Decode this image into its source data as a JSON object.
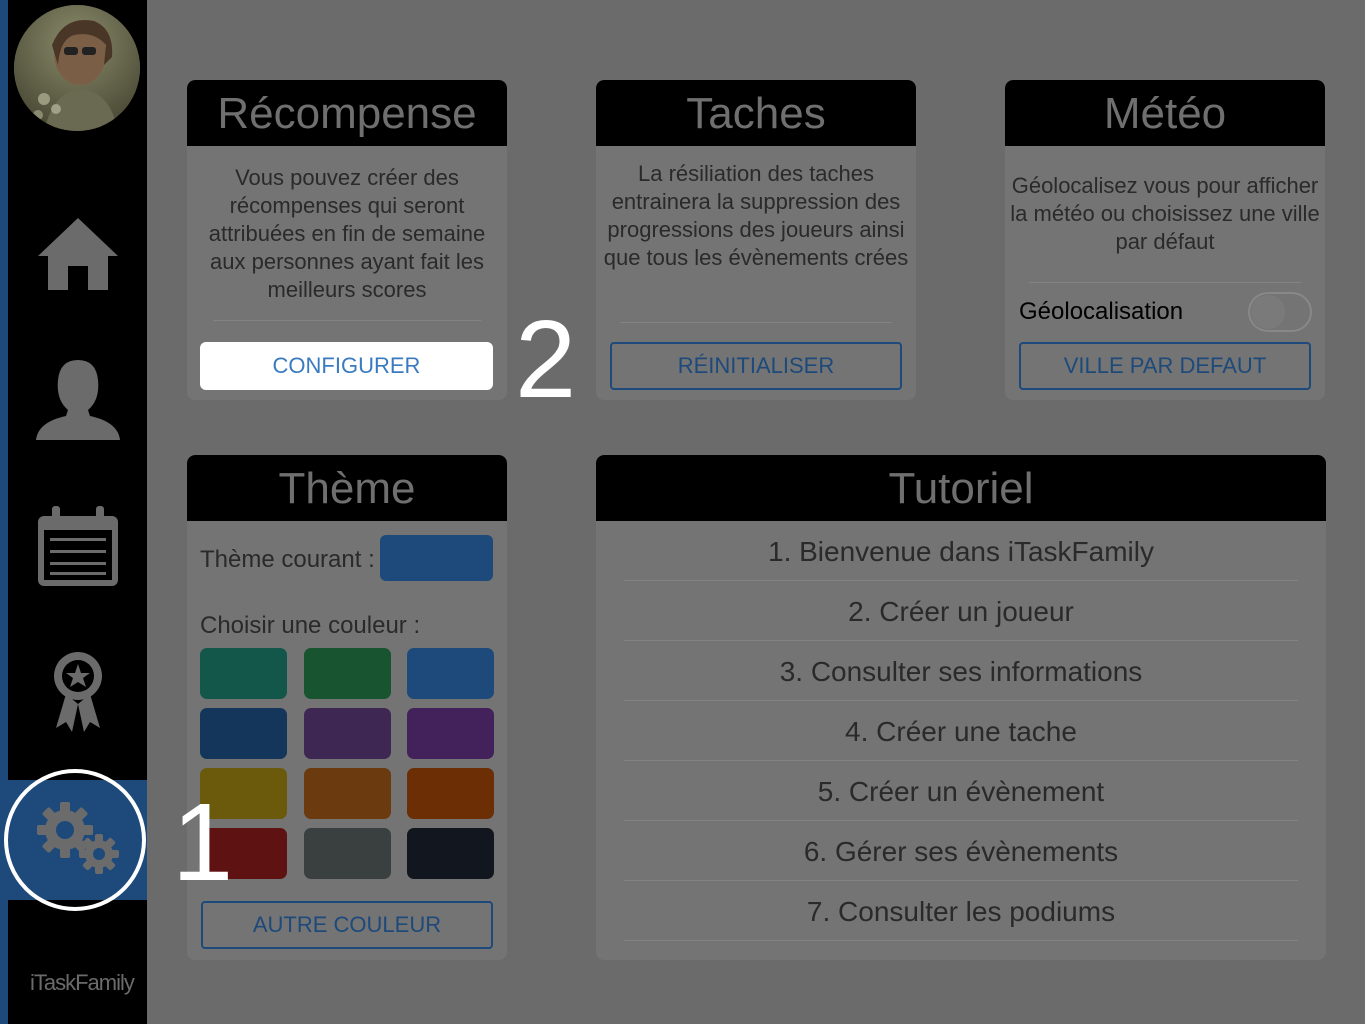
{
  "sidebar": {
    "logo_text": "iTaskFamily",
    "items": [
      {
        "name": "home",
        "icon": "home-icon"
      },
      {
        "name": "profile",
        "icon": "user-icon"
      },
      {
        "name": "calendar",
        "icon": "calendar-icon"
      },
      {
        "name": "rewards",
        "icon": "award-ribbon-icon"
      },
      {
        "name": "settings",
        "icon": "gears-icon",
        "active": true
      }
    ]
  },
  "recompense": {
    "title": "Récompense",
    "text": "Vous pouvez créer des récompenses qui seront attribuées en fin de semaine aux personnes ayant fait les meilleurs scores",
    "button": "CONFIGURER"
  },
  "taches": {
    "title": "Taches",
    "text": "La résiliation des taches entrainera la suppression des progressions des joueurs ainsi que tous les évènements crées",
    "button": "RÉINITIALISER"
  },
  "meteo": {
    "title": "Météo",
    "text": "Géolocalisez vous pour afficher la météo ou choisissez une ville par défaut",
    "toggle_label": "Géolocalisation",
    "toggle_on": false,
    "button": "VILLE PAR DEFAUT"
  },
  "theme": {
    "title": "Thème",
    "current_label": "Thème courant :",
    "current_color": "#1d4a7a",
    "choose_label": "Choisir une couleur :",
    "swatches": [
      "#13574a",
      "#17542f",
      "#1d4a7a",
      "#14365a",
      "#3e2753",
      "#43215a",
      "#6b5a0c",
      "#6b3a0e",
      "#6b2e05",
      "#5e1212",
      "#3a3f40",
      "#12161e"
    ],
    "button": "AUTRE COULEUR"
  },
  "tutoriel": {
    "title": "Tutoriel",
    "items": [
      "1. Bienvenue dans iTaskFamily",
      "2. Créer un joueur",
      "3. Consulter ses informations",
      "4. Créer une tache",
      "5. Créer un évènement",
      "6. Gérer ses évènements",
      "7. Consulter les podiums"
    ]
  },
  "annotations": {
    "step1": "1",
    "step2": "2"
  }
}
